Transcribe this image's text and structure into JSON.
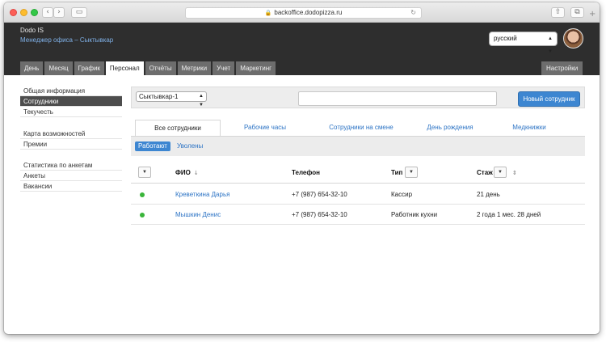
{
  "browser": {
    "url": "backoffice.dodopizza.ru"
  },
  "header": {
    "app_title": "Dodo IS",
    "subtitle": "Менеджер офиса – Сыктывкар",
    "language": "русский"
  },
  "topnav": {
    "tabs": [
      "День",
      "Месяц",
      "График",
      "Персонал",
      "Отчёты",
      "Метрики",
      "Учет",
      "Маркетинг"
    ],
    "active": "Персонал",
    "settings": "Настройки"
  },
  "sidebar": {
    "group1": [
      "Общая информация",
      "Сотрудники",
      "Текучесть"
    ],
    "group2": [
      "Карта возможностей",
      "Премии"
    ],
    "group3": [
      "Статистика по анкетам",
      "Анкеты",
      "Вакансии"
    ],
    "active": "Сотрудники"
  },
  "filter": {
    "city": "Сыктывкар-1",
    "search_value": "",
    "new_button": "Новый сотрудник"
  },
  "panel_tabs": [
    "Все сотрудники",
    "Рабочие часы",
    "Сотрудники на смене",
    "День рождения",
    "Медкнижки"
  ],
  "status_filter": {
    "active": "Работают",
    "other": "Уволены"
  },
  "table": {
    "headers": {
      "name": "ФИО",
      "phone": "Телефон",
      "type": "Тип",
      "tenure": "Стаж"
    },
    "rows": [
      {
        "status": "active",
        "name": "Креветкина Дарья",
        "phone": "+7 (987) 654-32-10",
        "type": "Кассир",
        "tenure": "21 день"
      },
      {
        "status": "active",
        "name": "Мышкин Денис",
        "phone": "+7 (987) 654-32-10",
        "type": "Работник кухни",
        "tenure": "2 года 1 мес. 28 дней"
      }
    ]
  },
  "colors": {
    "accent": "#3d86d1",
    "header_bg": "#2e2e2e",
    "status_active": "#3ab53a"
  }
}
